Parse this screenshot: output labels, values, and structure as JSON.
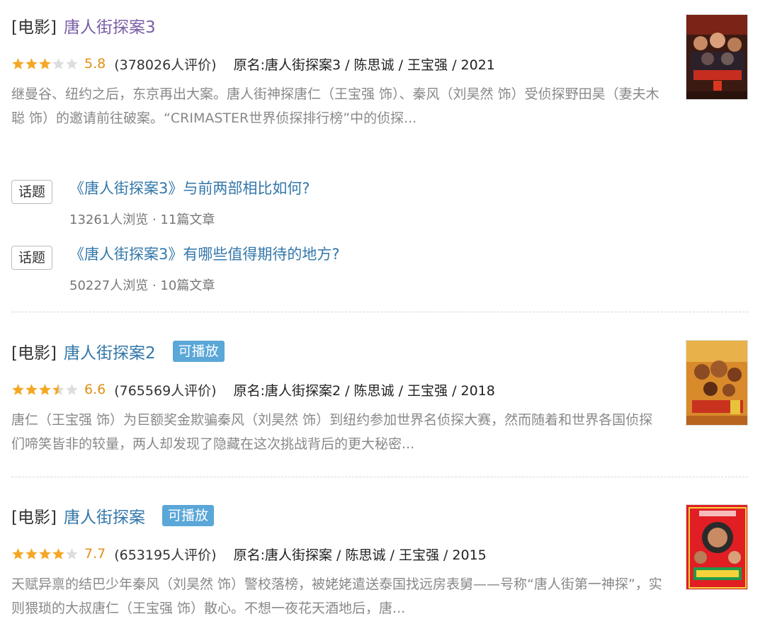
{
  "colors": {
    "link": "#3377aa",
    "visited_link": "#7a5fa6",
    "star_on": "#f5a623",
    "star_off": "#dddddd",
    "score": "#e09015",
    "playable_bg": "#5aa7d8"
  },
  "results": [
    {
      "category": "[电影]",
      "title": "唐人街探案3",
      "rating": 5.8,
      "stars": 3,
      "score_text": "5.8",
      "votes_text": "(378026人评价)",
      "meta_text": "原名:唐人街探案3 / 陈思诚 / 王宝强 / 2021",
      "description": "继曼谷、纽约之后，东京再出大案。唐人街神探唐仁（王宝强 饰）、秦风（刘昊然 饰）受侦探野田昊（妻夫木聪 饰）的邀请前往破案。“CRIMASTER世界侦探排行榜”中的侦探...",
      "topics": [
        {
          "tag": "话题",
          "title": "《唐人街探案3》与前两部相比如何?",
          "stats": "13261人浏览 · 11篇文章"
        },
        {
          "tag": "话题",
          "title": "《唐人街探案3》有哪些值得期待的地方?",
          "stats": "50227人浏览 · 10篇文章"
        }
      ]
    },
    {
      "category": "[电影]",
      "title": "唐人街探案2",
      "playable": "可播放",
      "rating": 6.6,
      "stars": 3.5,
      "score_text": "6.6",
      "votes_text": "(765569人评价)",
      "meta_text": "原名:唐人街探案2 / 陈思诚 / 王宝强 / 2018",
      "description": "唐仁（王宝强 饰）为巨额奖金欺骗秦风（刘昊然 饰）到纽约参加世界名侦探大赛，然而随着和世界各国侦探们啼笑皆非的较量，两人却发现了隐藏在这次挑战背后的更大秘密..."
    },
    {
      "category": "[电影]",
      "title": "唐人街探案",
      "playable": "可播放",
      "rating": 7.7,
      "stars": 4,
      "score_text": "7.7",
      "votes_text": "(653195人评价)",
      "meta_text": "原名:唐人街探案 / 陈思诚 / 王宝强 / 2015",
      "description": "天赋异禀的结巴少年秦风（刘昊然 饰）警校落榜，被姥姥遣送泰国找远房表舅——号称“唐人街第一神探”，实则猥琐的大叔唐仁（王宝强 饰）散心。不想一夜花天酒地后，唐..."
    }
  ]
}
